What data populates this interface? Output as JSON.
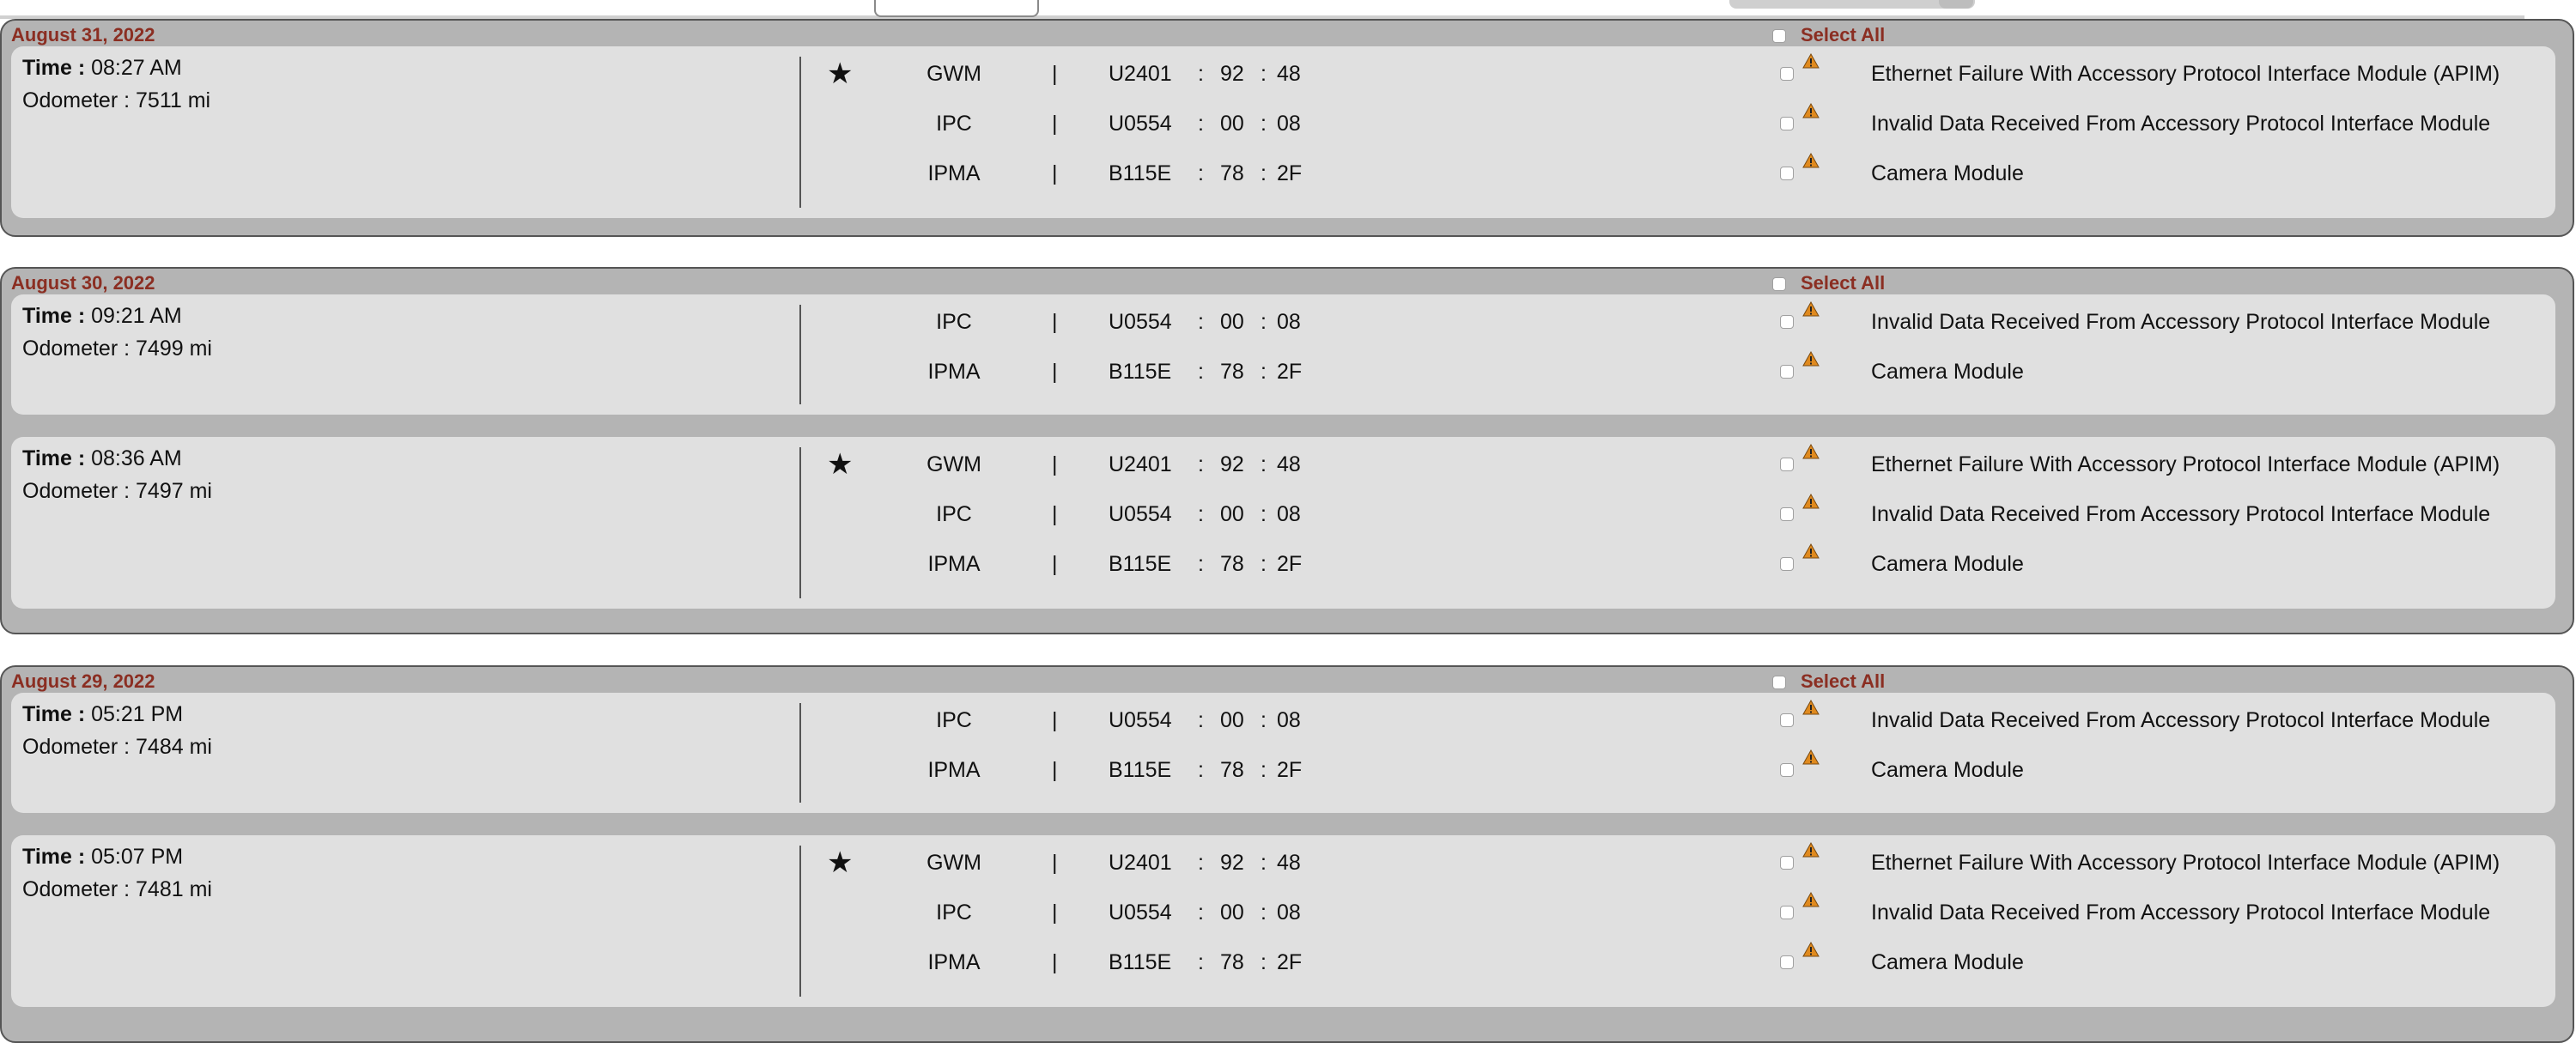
{
  "select_all_label": "Select All",
  "labels": {
    "time": "Time :",
    "odometer_prefix": "Odometer :"
  },
  "star_symbol": "★",
  "days": [
    {
      "date": "August 31, 2022",
      "records": [
        {
          "time": "08:27 AM",
          "odometer": "7511 mi",
          "codes": [
            {
              "starred": true,
              "module": "GWM",
              "dtc": "U2401",
              "v1": "92",
              "v2": "48",
              "description": "Ethernet Failure With Accessory Protocol Interface Module (APIM)"
            },
            {
              "starred": false,
              "module": "IPC",
              "dtc": "U0554",
              "v1": "00",
              "v2": "08",
              "description": "Invalid Data Received From Accessory Protocol Interface Module"
            },
            {
              "starred": false,
              "module": "IPMA",
              "dtc": "B115E",
              "v1": "78",
              "v2": "2F",
              "description": "Camera Module"
            }
          ]
        }
      ]
    },
    {
      "date": "August 30, 2022",
      "records": [
        {
          "time": "09:21 AM",
          "odometer": "7499 mi",
          "codes": [
            {
              "starred": false,
              "module": "IPC",
              "dtc": "U0554",
              "v1": "00",
              "v2": "08",
              "description": "Invalid Data Received From Accessory Protocol Interface Module"
            },
            {
              "starred": false,
              "module": "IPMA",
              "dtc": "B115E",
              "v1": "78",
              "v2": "2F",
              "description": "Camera Module"
            }
          ]
        },
        {
          "time": "08:36 AM",
          "odometer": "7497 mi",
          "codes": [
            {
              "starred": true,
              "module": "GWM",
              "dtc": "U2401",
              "v1": "92",
              "v2": "48",
              "description": "Ethernet Failure With Accessory Protocol Interface Module (APIM)"
            },
            {
              "starred": false,
              "module": "IPC",
              "dtc": "U0554",
              "v1": "00",
              "v2": "08",
              "description": "Invalid Data Received From Accessory Protocol Interface Module"
            },
            {
              "starred": false,
              "module": "IPMA",
              "dtc": "B115E",
              "v1": "78",
              "v2": "2F",
              "description": "Camera Module"
            }
          ]
        }
      ]
    },
    {
      "date": "August 29, 2022",
      "records": [
        {
          "time": "05:21 PM",
          "odometer": "7484 mi",
          "codes": [
            {
              "starred": false,
              "module": "IPC",
              "dtc": "U0554",
              "v1": "00",
              "v2": "08",
              "description": "Invalid Data Received From Accessory Protocol Interface Module"
            },
            {
              "starred": false,
              "module": "IPMA",
              "dtc": "B115E",
              "v1": "78",
              "v2": "2F",
              "description": "Camera Module"
            }
          ]
        },
        {
          "time": "05:07 PM",
          "odometer": "7481 mi",
          "codes": [
            {
              "starred": true,
              "module": "GWM",
              "dtc": "U2401",
              "v1": "92",
              "v2": "48",
              "description": "Ethernet Failure With Accessory Protocol Interface Module (APIM)"
            },
            {
              "starred": false,
              "module": "IPC",
              "dtc": "U0554",
              "v1": "00",
              "v2": "08",
              "description": "Invalid Data Received From Accessory Protocol Interface Module"
            },
            {
              "starred": false,
              "module": "IPMA",
              "dtc": "B115E",
              "v1": "78",
              "v2": "2F",
              "description": "Camera Module"
            }
          ]
        }
      ]
    }
  ],
  "colors": {
    "date_label": "#8b2e22",
    "day_bg": "#b4b4b4",
    "record_bg": "#e0e0e0",
    "warning": "#e08a1e"
  },
  "icons": {
    "warning": "warning-triangle-icon",
    "star": "star-icon"
  }
}
